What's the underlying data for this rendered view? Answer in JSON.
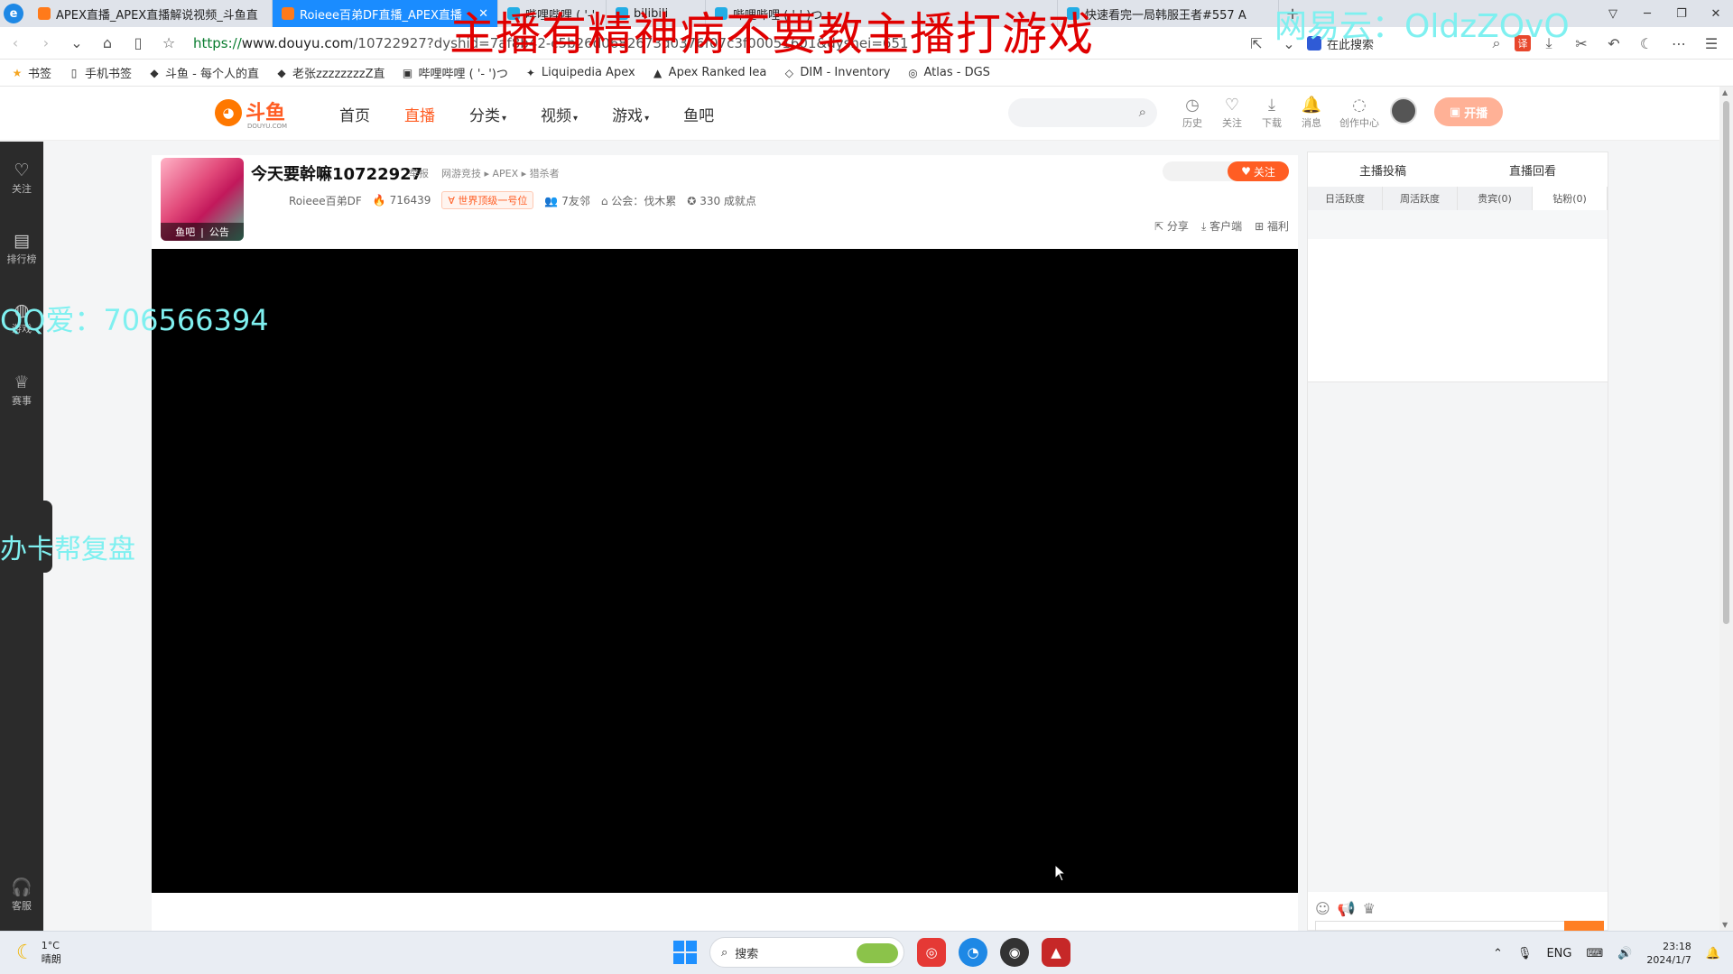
{
  "browser": {
    "tabs": [
      {
        "label": "APEX直播_APEX直播解说视频_斗鱼直",
        "active": false,
        "favicon": "douyu-icon"
      },
      {
        "label": "Roieee百弟DF直播_APEX直播_斗鱼",
        "active": true,
        "favicon": "douyu-icon"
      },
      {
        "label": "哔哩哔哩 ( '-' )つ",
        "active": false,
        "favicon": "bilibili-icon"
      },
      {
        "label": "bilibili",
        "active": false,
        "favicon": "bilibili-icon"
      },
      {
        "label": "哔哩哔哩 ( '-' )つ",
        "active": false,
        "favicon": "bilibili-icon"
      },
      {
        "label": "快速看完一局韩服王者#557 A",
        "active": false,
        "favicon": "bilibili-icon"
      }
    ],
    "new_tab": "+",
    "url_scheme": "https://",
    "url_host": "www.douyu.com",
    "url_rest": "/10722927?dyshid=7af8b42-c5b26d0682673d0376f07c3f00051601&dyshei=651",
    "search_engine_label": "在此搜索",
    "translate_label": "译",
    "bookmarks": [
      {
        "label": "书签",
        "icon": "star-icon"
      },
      {
        "label": "手机书签",
        "icon": "phone-icon"
      },
      {
        "label": "斗鱼 - 每个人的直",
        "icon": "douyu-icon"
      },
      {
        "label": "老张zzzzzzzzZ直",
        "icon": "douyu-icon"
      },
      {
        "label": "哔哩哔哩 ( '- ')つ",
        "icon": "bilibili-icon"
      },
      {
        "label": "Liquipedia Apex",
        "icon": "liquipedia-icon"
      },
      {
        "label": "Apex Ranked lea",
        "icon": "apex-icon"
      },
      {
        "label": "DIM - Inventory",
        "icon": "dim-icon"
      },
      {
        "label": "Atlas - DGS",
        "icon": "globe-icon"
      }
    ]
  },
  "site": {
    "logo_text": "斗鱼",
    "logo_sub": "DOUYU.COM",
    "nav": [
      {
        "label": "首页",
        "active": false,
        "dropdown": false
      },
      {
        "label": "直播",
        "active": true,
        "dropdown": false
      },
      {
        "label": "分类",
        "active": false,
        "dropdown": true
      },
      {
        "label": "视频",
        "active": false,
        "dropdown": true
      },
      {
        "label": "游戏",
        "active": false,
        "dropdown": true
      },
      {
        "label": "鱼吧",
        "active": false,
        "dropdown": false
      }
    ],
    "header_icons": [
      {
        "label": "历史",
        "icon": "clock-icon"
      },
      {
        "label": "关注",
        "icon": "heart-icon"
      },
      {
        "label": "下载",
        "icon": "download-icon"
      },
      {
        "label": "消息",
        "icon": "bell-icon"
      },
      {
        "label": "创作中心",
        "icon": "lightbulb-icon"
      }
    ],
    "live_button": "开播",
    "accent": "#ff5d23"
  },
  "left_rail": [
    {
      "label": "关注",
      "icon": "heart-icon"
    },
    {
      "label": "排行榜",
      "icon": "ranking-icon"
    },
    {
      "label": "游戏",
      "icon": "gamepad-icon"
    },
    {
      "label": "赛事",
      "icon": "trophy-icon"
    },
    {
      "label": "客服",
      "icon": "headset-icon"
    }
  ],
  "room": {
    "title": "今天要幹嘛10722927",
    "report": "举报",
    "breadcrumb": "网游竞技 ▸ APEX ▸ 猎杀者",
    "avatar_footer": [
      "鱼吧",
      "公告"
    ],
    "streamer": "Roieee百弟DF",
    "hot": "716439",
    "rank_tag": "世界顶级一号位",
    "neighbors": "7友邻",
    "guild": "公会：伐木累",
    "achievement": "330 成就点",
    "follow": "关注",
    "actions": [
      "分享",
      "客户端",
      "福利"
    ]
  },
  "right_panel": {
    "tabs": [
      "主播投稿",
      "直播回看"
    ],
    "rank_tabs": [
      {
        "label": "日活跃度",
        "active": false
      },
      {
        "label": "周活跃度",
        "active": false
      },
      {
        "label": "贵宾(0)",
        "active": false
      },
      {
        "label": "钻粉(0)",
        "active": true
      }
    ]
  },
  "overlays": {
    "title": "主播有精神病不要教主播打游戏",
    "netease": "网易云：OldzZOvO",
    "qq": "QQ爱：706566394",
    "banner": "办卡帮复盘"
  },
  "taskbar": {
    "temperature": "1°C",
    "weather": "晴朗",
    "search_label": "搜索",
    "lang": "ENG",
    "time": "23:18",
    "date": "2024/1/7"
  }
}
